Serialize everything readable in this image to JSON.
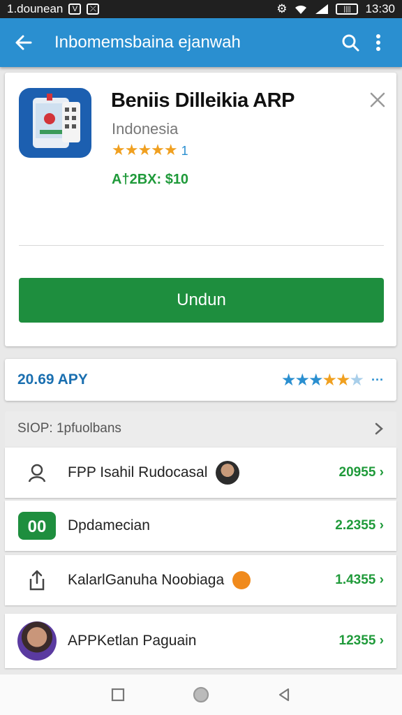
{
  "status_bar": {
    "left_text": "1.dounean",
    "battery": "||||",
    "time": "13:30"
  },
  "app_bar": {
    "title": "Inbomemsbaina ejanwah"
  },
  "app": {
    "name": "Beniis Dilleikia ARP",
    "country": "Indonesia",
    "stars": "★★★★★",
    "rating_count": "1",
    "price": "A†2BX: $10",
    "install_label": "Undun"
  },
  "rating_bar": {
    "label": "20.69 APY",
    "more": "···"
  },
  "list": {
    "header": "SIOP: 1pfuolbans",
    "items": [
      {
        "label": "FPP Isahil Rudocasal",
        "price": "20955"
      },
      {
        "label": "Dpdamecian",
        "price": "2.2355"
      },
      {
        "label": "KalarlGanuha Noobiaga",
        "price": "1.4355"
      },
      {
        "label": "APPKetlan Paguain",
        "price": "12355"
      }
    ]
  },
  "colors": {
    "app_bar": "#2a8fd0",
    "install_button": "#1e8e3e",
    "price_green": "#1f9a3a"
  }
}
